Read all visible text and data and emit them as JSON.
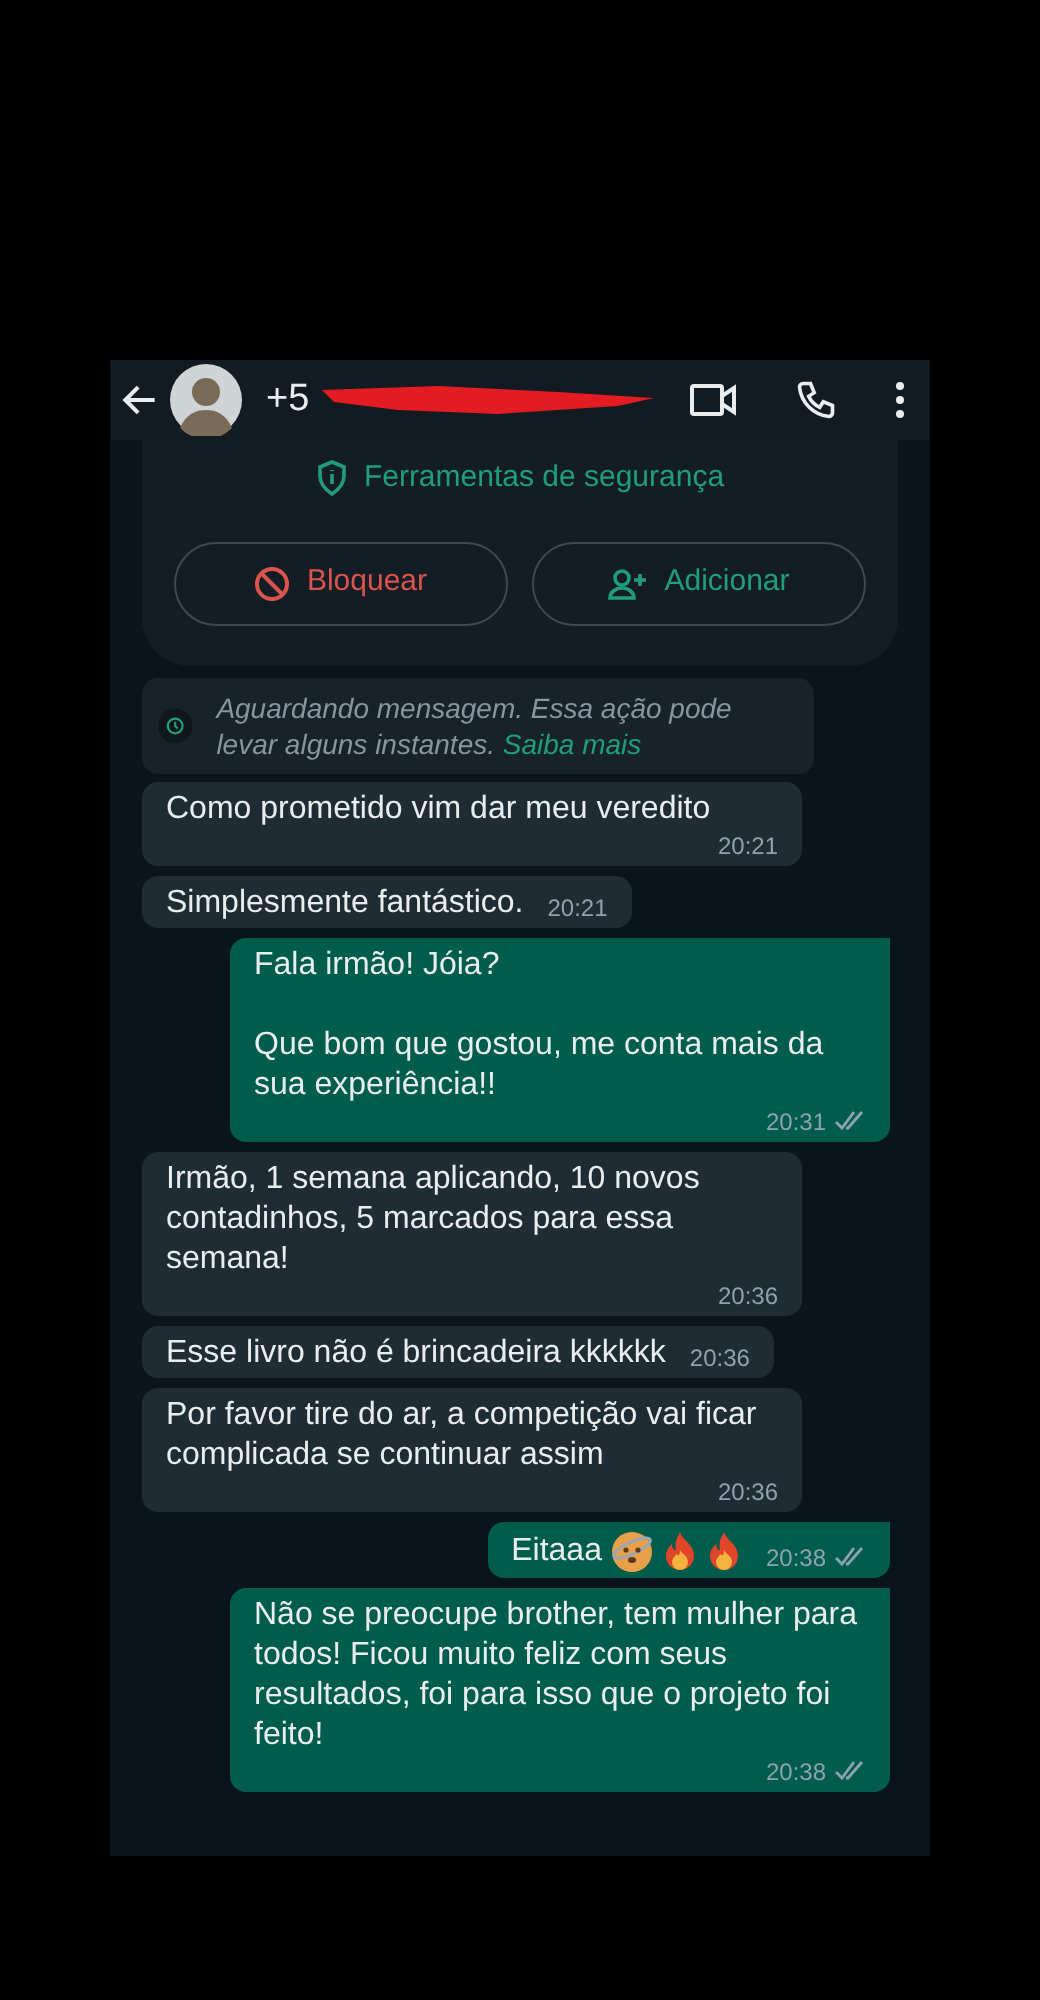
{
  "header": {
    "title": "+5",
    "redacted": true
  },
  "security_card": {
    "title": "Ferramentas de segurança",
    "buttons": [
      {
        "label": "Bloquear",
        "kind": "block"
      },
      {
        "label": "Adicionar",
        "kind": "add"
      }
    ]
  },
  "notice": {
    "text": "Aguardando mensagem. Essa ação pode levar alguns instantes.",
    "link": "Saiba mais"
  },
  "messages": [
    {
      "kind": "incoming",
      "text": "Como prometido vim dar meu veredito",
      "time": "20:21"
    },
    {
      "kind": "incoming",
      "text": "Simplesmente fantástico.",
      "time": "20:21"
    },
    {
      "kind": "outgoing",
      "text": "Fala irmão! Jóia?\n\nQue bom que gostou, me conta mais da sua experiência!!",
      "time": "20:31",
      "read": true
    },
    {
      "kind": "incoming",
      "text": "Irmão, 1 semana aplicando, 10 novos contadinhos, 5 marcados para essa semana!",
      "time": "20:36"
    },
    {
      "kind": "incoming",
      "text": "Esse livro não é brincadeira kkkkkk",
      "time": "20:36"
    },
    {
      "kind": "incoming",
      "text": "Por favor tire do ar, a competição vai ficar complicada se continuar assim",
      "time": "20:36"
    },
    {
      "kind": "outgoing",
      "text": "Eitaaa",
      "emojis": [
        {
          "kind": "dizzy"
        },
        {
          "kind": "fire"
        },
        {
          "kind": "fire"
        }
      ],
      "time": "20:38",
      "read": true
    },
    {
      "kind": "outgoing",
      "text": "Não se preocupe brother, tem mulher para todos! Ficou muito feliz com seus resultados, foi para isso que o projeto foi feito!",
      "time": "20:38",
      "read": true
    }
  ]
}
